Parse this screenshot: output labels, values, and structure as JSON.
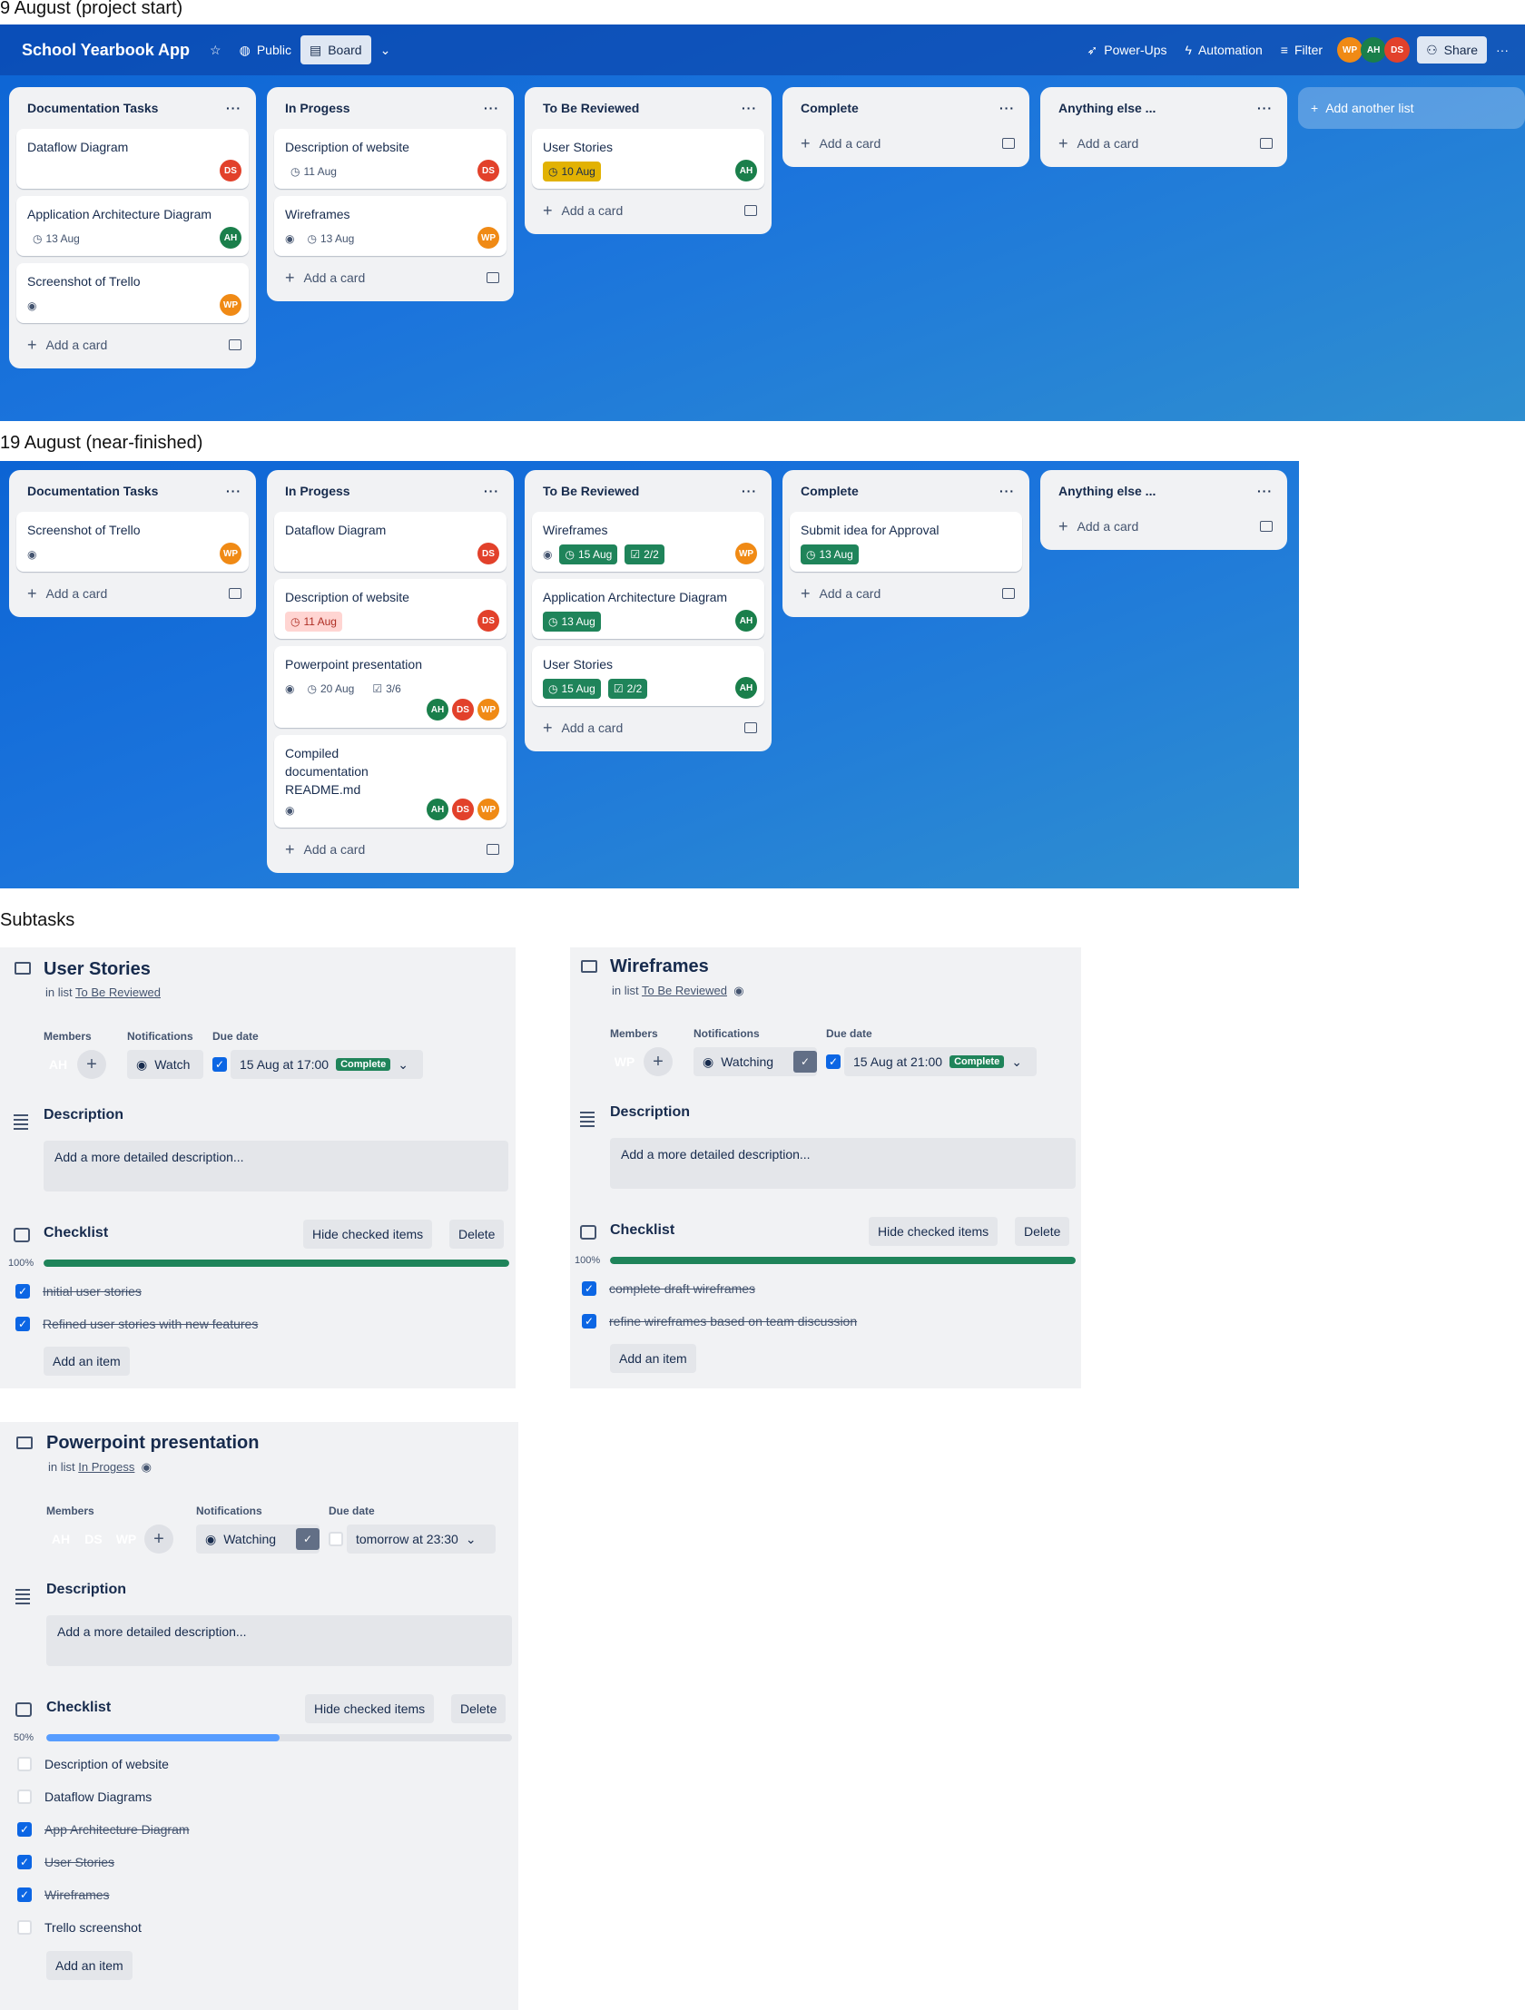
{
  "sections": {
    "start_title": "9 August (project start)",
    "near_title": "19 August (near-finished)",
    "subtasks_title": "Subtasks"
  },
  "topbar": {
    "board_name": "School Yearbook App",
    "visibility": "Public",
    "view": "Board",
    "powerups": "Power-Ups",
    "automation": "Automation",
    "filter": "Filter",
    "share": "Share",
    "members": [
      "WP",
      "AH",
      "DS"
    ]
  },
  "common": {
    "add_card": "Add a card",
    "add_list": "Add another list",
    "list_menu": "···"
  },
  "board1": {
    "lists": [
      {
        "title": "Documentation Tasks",
        "cards": [
          {
            "title": "Dataflow Diagram",
            "date": "",
            "members": [
              "DS"
            ]
          },
          {
            "title": "Application Architecture Diagram",
            "date": "13 Aug",
            "members": [
              "AH"
            ]
          },
          {
            "title": "Screenshot of Trello",
            "date": "",
            "members": [
              "WP"
            ]
          }
        ]
      },
      {
        "title": "In Progess",
        "cards": [
          {
            "title": "Description of website",
            "date": "11 Aug",
            "members": [
              "DS"
            ]
          },
          {
            "title": "Wireframes",
            "date": "13 Aug",
            "members": [
              "WP"
            ]
          }
        ]
      },
      {
        "title": "To Be Reviewed",
        "cards": [
          {
            "title": "User Stories",
            "date": "10 Aug",
            "members": [
              "AH"
            ]
          }
        ]
      },
      {
        "title": "Complete",
        "cards": []
      },
      {
        "title": "Anything else ...",
        "cards": []
      }
    ]
  },
  "board2": {
    "lists": [
      {
        "title": "Documentation Tasks",
        "cards": [
          {
            "title": "Screenshot of Trello",
            "members": [
              "WP"
            ]
          }
        ]
      },
      {
        "title": "In Progess",
        "cards": [
          {
            "title": "Dataflow Diagram",
            "members": [
              "DS"
            ]
          },
          {
            "title": "Description of website",
            "date": "11 Aug",
            "members": [
              "DS"
            ]
          },
          {
            "title": "Powerpoint presentation",
            "date": "20 Aug",
            "checklist": "3/6",
            "members": [
              "AH",
              "DS",
              "WP"
            ]
          },
          {
            "title": "Compiled documentation README.md",
            "members": [
              "AH",
              "DS",
              "WP"
            ]
          }
        ]
      },
      {
        "title": "To Be Reviewed",
        "cards": [
          {
            "title": "Wireframes",
            "date": "15 Aug",
            "checklist": "2/2",
            "members": [
              "WP"
            ]
          },
          {
            "title": "Application Architecture Diagram",
            "date": "13 Aug",
            "members": [
              "AH"
            ]
          },
          {
            "title": "User Stories",
            "date": "15 Aug",
            "checklist": "2/2",
            "members": [
              "AH"
            ]
          }
        ]
      },
      {
        "title": "Complete",
        "cards": [
          {
            "title": "Submit idea for Approval",
            "date": "13 Aug",
            "members": []
          }
        ]
      },
      {
        "title": "Anything else ...",
        "cards": []
      }
    ]
  },
  "labels": {
    "members": "Members",
    "notifications": "Notifications",
    "due_date": "Due date",
    "description": "Description",
    "desc_placeholder": "Add a more detailed description...",
    "checklist": "Checklist",
    "hide_checked": "Hide checked items",
    "delete": "Delete",
    "add_item": "Add an item",
    "in_list": "in list",
    "complete": "Complete"
  },
  "panels": {
    "user_stories": {
      "title": "User Stories",
      "list": "To Be Reviewed",
      "members": [
        "AH"
      ],
      "watch": "Watch",
      "due": "15 Aug at 17:00",
      "progress": 100,
      "progress_label": "100%",
      "items": [
        {
          "text": "Initial user stories",
          "done": true
        },
        {
          "text": "Refined user stories with new features",
          "done": true
        }
      ]
    },
    "wireframes": {
      "title": "Wireframes",
      "list": "To Be Reviewed",
      "members": [
        "WP"
      ],
      "watch": "Watching",
      "due": "15 Aug at 21:00",
      "progress": 100,
      "progress_label": "100%",
      "items": [
        {
          "text": "complete draft wireframes",
          "done": true
        },
        {
          "text": "refine wireframes based on team discussion",
          "done": true
        }
      ]
    },
    "powerpoint": {
      "title": "Powerpoint presentation",
      "list": "In Progess",
      "members": [
        "AH",
        "DS",
        "WP"
      ],
      "watch": "Watching",
      "due": "tomorrow at 23:30",
      "progress": 50,
      "progress_label": "50%",
      "items": [
        {
          "text": "Description of website",
          "done": false
        },
        {
          "text": "Dataflow Diagrams",
          "done": false
        },
        {
          "text": "App Architecture Diagram",
          "done": true
        },
        {
          "text": "User Stories",
          "done": true
        },
        {
          "text": "Wireframes",
          "done": true
        },
        {
          "text": "Trello screenshot",
          "done": false
        }
      ]
    }
  }
}
